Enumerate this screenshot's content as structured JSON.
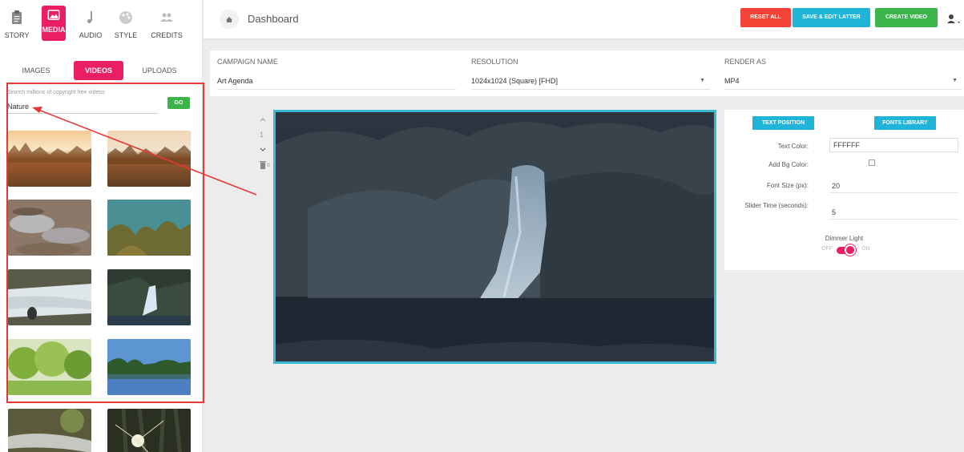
{
  "nav": {
    "items": [
      {
        "label": "STORY",
        "icon": "clipboard-icon"
      },
      {
        "label": "MEDIA",
        "icon": "image-icon"
      },
      {
        "label": "AUDIO",
        "icon": "music-note-icon"
      },
      {
        "label": "STYLE",
        "icon": "palette-icon"
      },
      {
        "label": "CREDITS",
        "icon": "people-icon"
      }
    ],
    "active": "MEDIA"
  },
  "media_tabs": {
    "images": "IMAGES",
    "videos": "VIDEOS",
    "uploads": "UPLOADS",
    "active": "VIDEOS"
  },
  "search": {
    "hint": "Search millions of copyright free videos",
    "value": "Nature",
    "go_label": "GO"
  },
  "thumbnails": [
    "autumn grass sunset",
    "autumn grass field",
    "rocky stream water",
    "underwater coral",
    "rapid river",
    "waterfall",
    "green forest",
    "lake with trees",
    "forest creek",
    "sunlight through trees"
  ],
  "header": {
    "title": "Dashboard",
    "home_icon": "home-icon",
    "reset_label": "RESET ALL",
    "save_label": "SAVE & EDIT LATTER",
    "create_label": "CREATE VIDEO",
    "user_icon": "user-icon",
    "colors": {
      "reset": "#f44336",
      "save": "#1fb4d8",
      "create": "#3bb54a",
      "accent": "#e91e63"
    }
  },
  "form": {
    "campaign_label": "CAMPAIGN NAME",
    "campaign_value": "Art Agenda",
    "resolution_label": "RESOLUTION",
    "resolution_value": "1024x1024 (Square) [FHD]",
    "render_label": "RENDER AS",
    "render_value": "MP4"
  },
  "slide": {
    "number": "1",
    "up_icon": "chevron-up-icon",
    "down_icon": "chevron-down-icon",
    "delete_icon": "trash-icon"
  },
  "settings": {
    "text_position_label": "TEXT POSITION",
    "fonts_library_label": "FONTS LIBRARY",
    "text_color_label": "Text Color:",
    "text_color_value": "FFFFFF",
    "add_bg_label": "Add Bg Color:",
    "font_size_label": "Font Size (px):",
    "font_size_value": "20",
    "slider_time_label": "Slider Time (seconds):",
    "slider_time_value": "5",
    "dimmer_label": "Dimmer Light",
    "toggle_off": "OFF",
    "toggle_on": "ON"
  }
}
